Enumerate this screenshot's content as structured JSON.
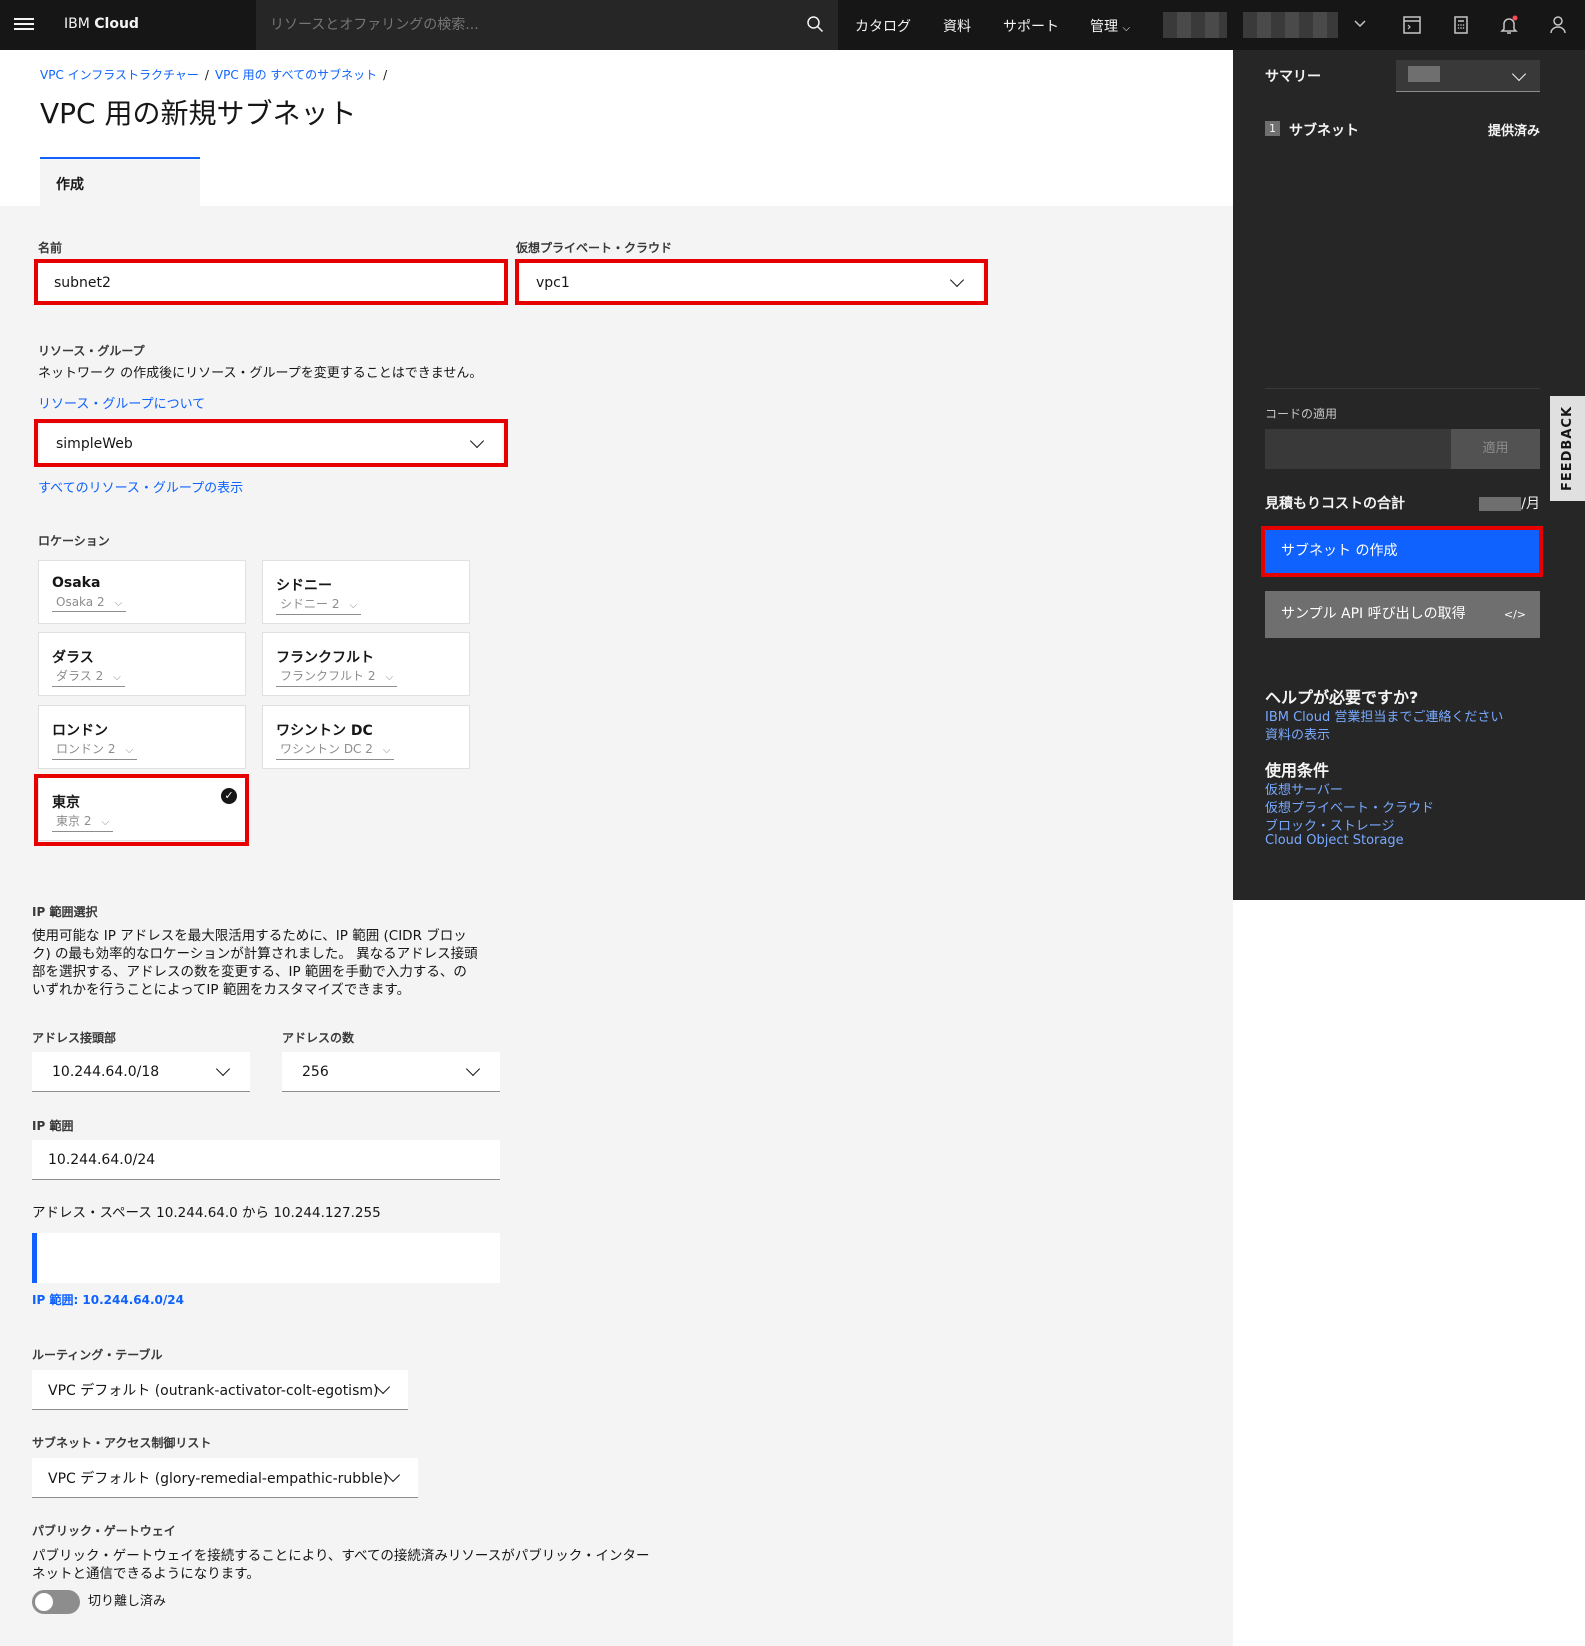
{
  "header": {
    "brand_prefix": "IBM",
    "brand_name": "Cloud",
    "search_placeholder": "リソースとオファリングの検索...",
    "nav": [
      "カタログ",
      "資料",
      "サポート",
      "管理"
    ]
  },
  "breadcrumb": [
    "VPC インフラストラクチャー",
    "VPC 用の すべてのサブネット"
  ],
  "page_title": "VPC 用の新規サブネット",
  "tab_label": "作成",
  "form": {
    "name_label": "名前",
    "name_value": "subnet2",
    "vpc_label": "仮想プライベート・クラウド",
    "vpc_value": "vpc1",
    "rg_label": "リソース・グループ",
    "rg_help": "ネットワーク の作成後にリソース・グループを変更することはできません。",
    "rg_link": "リソース・グループについて",
    "rg_value": "simpleWeb",
    "rg_all_link": "すべてのリソース・グループの表示",
    "location_label": "ロケーション",
    "locations": [
      {
        "name": "Osaka",
        "zone": "Osaka 2"
      },
      {
        "name": "シドニー",
        "zone": "シドニー 2"
      },
      {
        "name": "ダラス",
        "zone": "ダラス 2"
      },
      {
        "name": "フランクフルト",
        "zone": "フランクフルト 2"
      },
      {
        "name": "ロンドン",
        "zone": "ロンドン 2"
      },
      {
        "name": "ワシントン DC",
        "zone": "ワシントン DC 2"
      },
      {
        "name": "東京",
        "zone": "東京 2"
      }
    ],
    "ip_select_label": "IP 範囲選択",
    "ip_select_text": [
      "使用可能な IP アドレスを最大限活用するために、IP 範囲 (CIDR ブロッ",
      "ク) の最も効率的なロケーションが計算されました。 異なるアドレス接頭",
      "部を選択する、アドレスの数を変更する、IP 範囲を手動で入力する、の",
      "いずれかを行うことによってIP 範囲をカスタマイズできます。"
    ],
    "prefix_label": "アドレス接頭部",
    "prefix_value": "10.244.64.0/18",
    "count_label": "アドレスの数",
    "count_value": "256",
    "ip_range_label": "IP 範囲",
    "ip_range_value": "10.244.64.0/24",
    "address_space": "アドレス・スペース  10.244.64.0 から 10.244.127.255",
    "ip_range_caption": "IP 範囲: 10.244.64.0/24",
    "routing_label": "ルーティング・テーブル",
    "routing_value": "VPC デフォルト (outrank-activator-colt-egotism)",
    "acl_label": "サブネット・アクセス制御リスト",
    "acl_value": "VPC デフォルト (glory-remedial-empathic-rubble)",
    "gateway_label": "パブリック・ゲートウェイ",
    "gateway_text": [
      "パブリック・ゲートウェイを接続することにより、すべての接続済みリソースがパブリック・インター",
      "ネットと通信できるようになります。"
    ],
    "gateway_state": "切り離し済み"
  },
  "summary": {
    "title": "サマリー",
    "item_count": "1",
    "item_label": "サブネット",
    "item_status": "提供済み",
    "code_label": "コードの適用",
    "apply_label": "適用",
    "cost_label": "見積もりコストの合計",
    "cost_unit": "/月",
    "create_button": "サブネット の作成",
    "api_button": "サンプル API 呼び出しの取得",
    "api_icon": "</>",
    "help_title": "ヘルプが必要ですか?",
    "help_links": [
      "IBM Cloud 営業担当までご連絡ください",
      "資料の表示"
    ],
    "terms_title": "使用条件",
    "terms_links": [
      "仮想サーバー",
      "仮想プライベート・クラウド",
      "ブロック・ストレージ",
      "Cloud Object Storage"
    ]
  },
  "feedback": "FEEDBACK",
  "accent": "#0f62fe",
  "highlight": "#e60000"
}
